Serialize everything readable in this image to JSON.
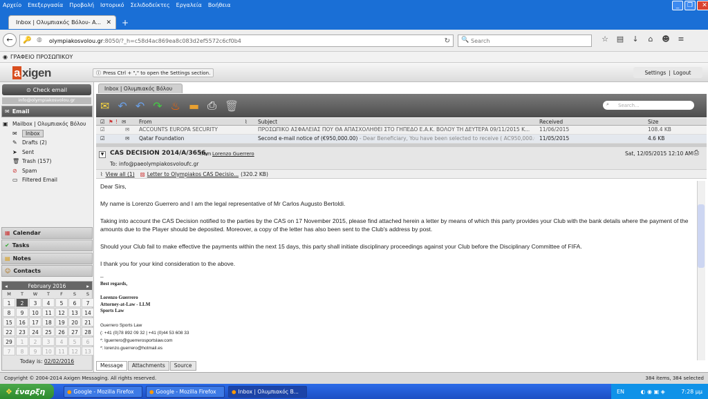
{
  "browser": {
    "menu": [
      "Αρχείο",
      "Επεξεργασία",
      "Προβολή",
      "Ιστορικό",
      "Σελιδοδείκτες",
      "Εργαλεία",
      "Βοήθεια"
    ],
    "tab_title": "Inbox | Ολυμπιακός Βόλου- A...",
    "url_host": "olympiakosvolou.gr",
    "url_rest": ":8050/?_h=c58d4ac869ea8c083d2ef5572c6cf0b4",
    "search_placeholder": "Search",
    "bookmark": "ΓΡΑΦΕΙΟ ΠΡΟΣΩΠΙΚΟΥ"
  },
  "app": {
    "logo_a": "a",
    "logo_rest": "xigen",
    "hint": "Press Ctrl + \",\" to open the Settings section.",
    "settings": "Settings",
    "logout": "Logout",
    "check_email": "Check email",
    "account": "info@olympiakosvolou.gr",
    "email_section": "Email",
    "mailbox": "Mailbox | Ολυμπιακός Βόλου",
    "folders": [
      "Inbox",
      "Drafts (2)",
      "Sent",
      "Trash (157)",
      "Spam",
      "Filtered Email"
    ],
    "sections": [
      "Calendar",
      "Tasks",
      "Notes",
      "Contacts"
    ],
    "calendar": {
      "month": "February 2016",
      "days": [
        "M",
        "T",
        "W",
        "T",
        "F",
        "S",
        "S"
      ],
      "cells": [
        "1",
        "2",
        "3",
        "4",
        "5",
        "6",
        "7",
        "8",
        "9",
        "10",
        "11",
        "12",
        "13",
        "14",
        "15",
        "16",
        "17",
        "18",
        "19",
        "20",
        "21",
        "22",
        "23",
        "24",
        "25",
        "26",
        "27",
        "28",
        "29",
        "1",
        "2",
        "3",
        "4",
        "5",
        "6",
        "7",
        "8",
        "9",
        "10",
        "11",
        "12",
        "13"
      ],
      "today_label": "Today is:",
      "today": "02/02/2016"
    }
  },
  "mail": {
    "tab": "Inbox | Ολυμπιακός Βόλου",
    "search_placeholder": "Search...",
    "columns": [
      "From",
      "Subject",
      "Received",
      "Size"
    ],
    "rows": [
      {
        "from": "ACCOUNTS EUROPA SECURITY",
        "subject": "ΠΡΟΣΩΠΙΚΟ ΑΣΦΑΛΕΙΑΣ ΠΟΥ ΘΑ ΑΠΑΣΧΟΛΗΘΕΙ ΣΤΟ ΓΗΠΕΔΟ Ε.Α.Κ. ΒΟΛΟΥ ΤΗ ΔΕΥΤΕΡΑ 09/11/2015 Κ...",
        "received": "11/06/2015",
        "size": "108.4 KB"
      },
      {
        "from": "Qatar Foundation",
        "subject": "Second e-mail notice of (€950,000.00)",
        "preview": " - Dear Beneficiary, You have been selected to receive ( AC950,000.00 ...",
        "received": "11/05/2015",
        "size": "4.6 KB"
      }
    ],
    "message": {
      "subject": "CAS DECISION 2014/A/3656,",
      "from_label": "from",
      "from": "Lorenzo Guerrero",
      "date": "Sat, 12/05/2015 12:10 AM",
      "to_label": "To:",
      "to": "info@paeolympiakosvoloufc.gr",
      "view_all": "View all (1)",
      "attachment": "Letter to Olympiakos CAS Decisio...",
      "attachment_size": "(320.2 KB)",
      "greeting": "Dear Sirs,",
      "p1": "My name is Lorenzo Guerrero and I am the legal representative of Mr Carlos Augusto Bertoldi.",
      "p2": "Taking into account the CAS Decision notified to the parties by the CAS on 17 November 2015, please find attached herein a letter by means of which this party provides your Club with the bank details where the payment of the amounts due to the Player should be deposited.  Moreover, a copy of the letter has also been sent to the Club's address by post.",
      "p3": "Should your Club fail to make effective the payments within the next 15 days, this party shall initiate disciplinary proceedings against your Club before the Disciplinary Committee of FIFA.",
      "p4": "I thank you for your kind consideration to the above.",
      "dash": "--",
      "regards": "Best regards,",
      "sig_name": "Lorenzo Guerrero",
      "sig_title": "Attorney-at-Law - LLM",
      "sig_firm": "Sports Law",
      "firm": "Guerrero Sports Law",
      "phone": "(: +41 (0)78 892 09 32 | +41 (0)44 53 608 33",
      "email1": "*: lguerrero@guerrerosportslaw.com",
      "email2": "*: lorenzo.guerrero@hotmail.es"
    },
    "bottom_tabs": [
      "Message",
      "Attachments",
      "Source"
    ]
  },
  "status": {
    "copyright": "Copyright © 2004-2014 Axigen Messaging. All rights reserved.",
    "count": "384 items, 384 selected"
  },
  "taskbar": {
    "start": "έναρξη",
    "tasks": [
      "Google - Mozilla Firefox",
      "Google - Mozilla Firefox",
      "Inbox | Ολυμπιακός Β..."
    ],
    "lang": "EN",
    "time": "7:28 μμ"
  }
}
